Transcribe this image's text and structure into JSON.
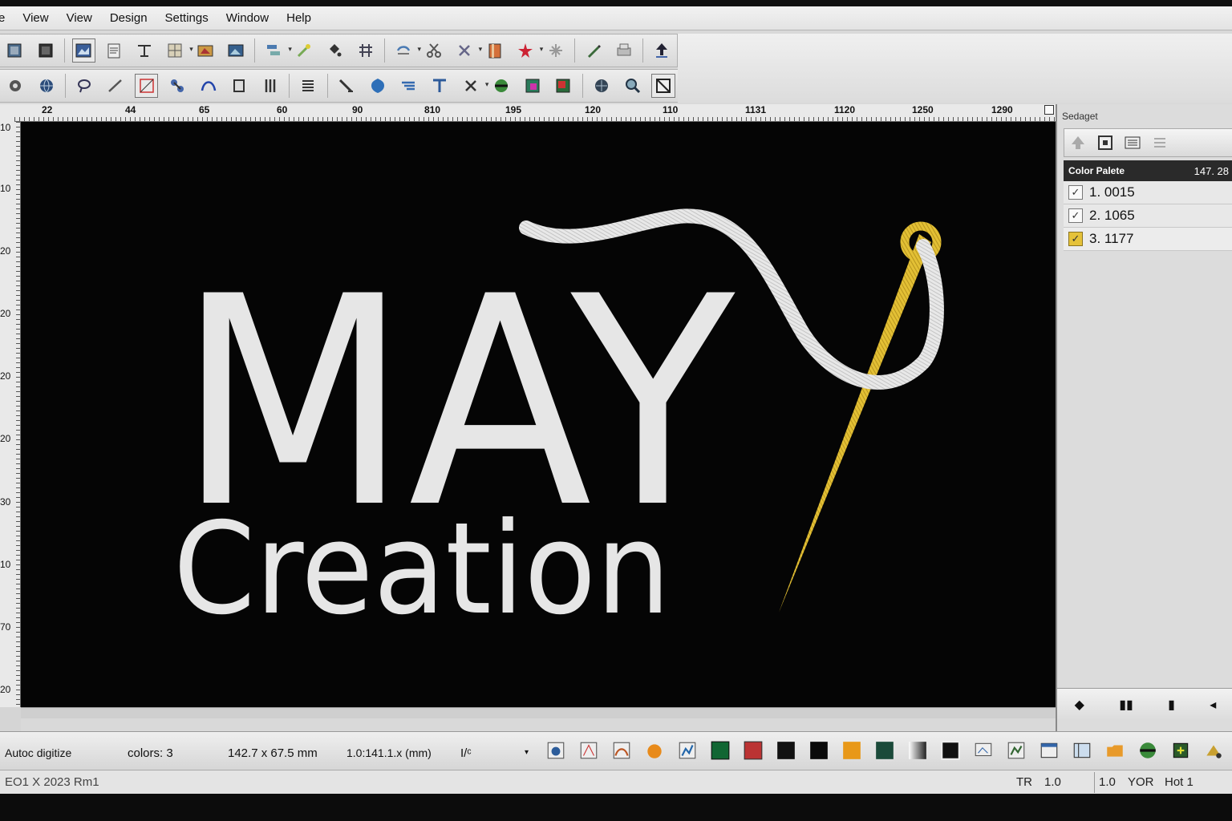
{
  "menu": [
    "e",
    "View",
    "View",
    "Design",
    "Settings",
    "Window",
    "Help"
  ],
  "ruler_top_labels": [
    "22",
    "44",
    "65",
    "60",
    "90",
    "810",
    "195",
    "120",
    "110",
    "1131",
    "1120",
    "1250",
    "1290"
  ],
  "ruler_left_labels": [
    "10",
    "10",
    "20",
    "20",
    "20",
    "20",
    "30",
    "10",
    "70",
    "20"
  ],
  "design": {
    "line1": "MAY",
    "line2": "Creation",
    "thread_color": "#e6e6e6",
    "needle_color": "#e2bf33",
    "background": "#050505"
  },
  "panel": {
    "title": "Sedaget",
    "palette_title": "Color Palete",
    "palette_value": "147. 28",
    "colors": [
      {
        "label": "1. 0015",
        "check": "✓"
      },
      {
        "label": "2. 1065",
        "check": "✓"
      },
      {
        "label": "3. 1177",
        "check": "✓"
      }
    ],
    "nav": [
      "◆",
      "▮▮",
      "▮",
      "◂"
    ]
  },
  "status": {
    "mode": "Autoc digitize",
    "colors": "colors: 3",
    "size": "142.7 x 67.5 mm",
    "scale": "1.0:141.1.x (mm)",
    "extra": "I/ᶜ",
    "file": "EO1 X 2023 Rm1",
    "tr_label": "TR",
    "tr_value": "1.0",
    "val2": "1.0",
    "yor": "YOR",
    "hot": "Hot 1"
  }
}
